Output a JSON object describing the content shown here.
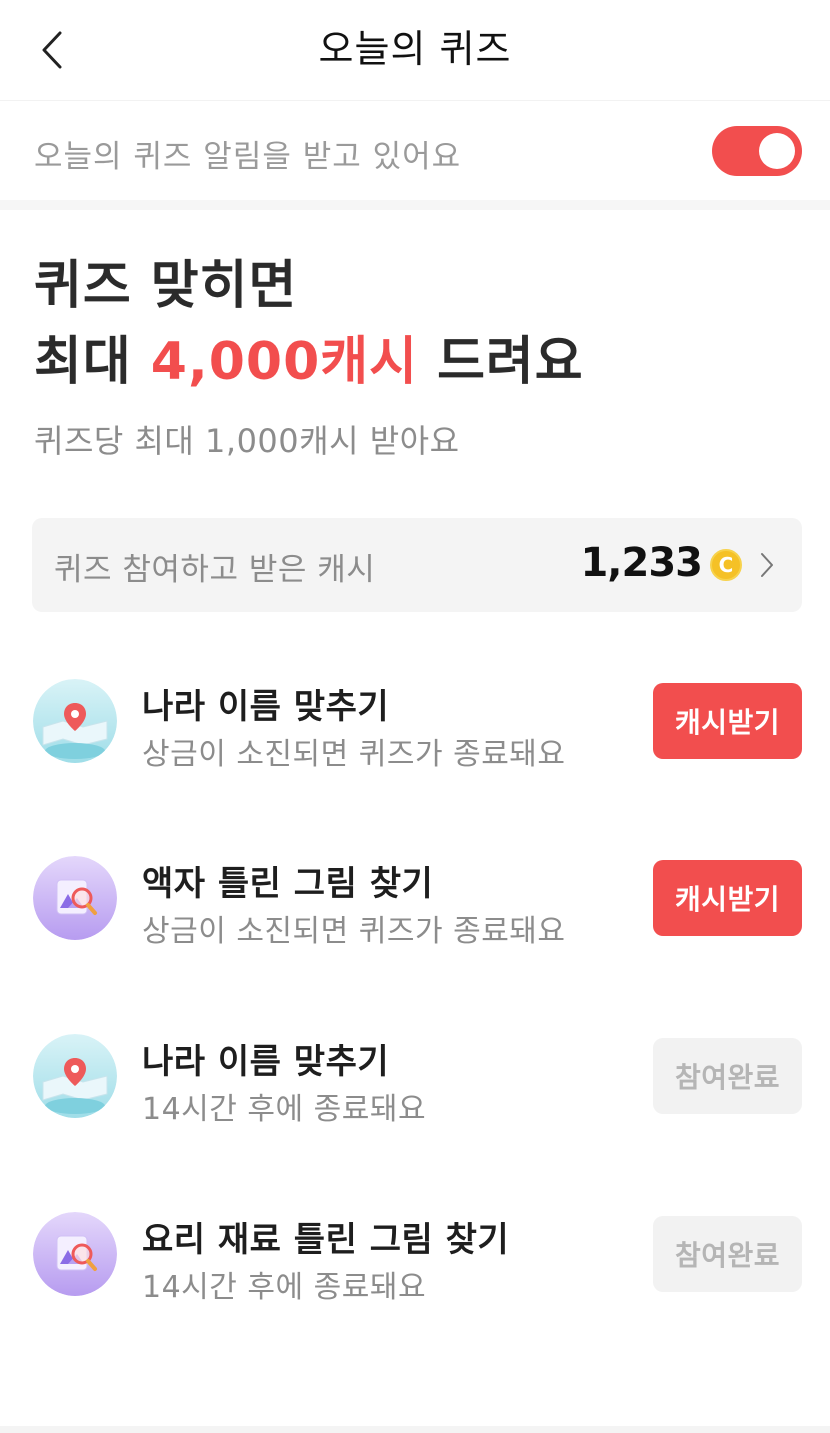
{
  "header": {
    "title": "오늘의 퀴즈",
    "back_icon": "chevron-left-icon"
  },
  "notification": {
    "label": "오늘의 퀴즈 알림을 받고 있어요",
    "toggle_on": true,
    "toggle_color": "#f24e4e"
  },
  "hero": {
    "line1": "퀴즈 맞히면",
    "line2_prefix": "최대 ",
    "line2_accent": "4,000캐시",
    "line2_suffix": " 드려요",
    "subtitle": "퀴즈당 최대 1,000캐시 받아요",
    "accent_color": "#f24e4e"
  },
  "earned": {
    "label": "퀴즈 참여하고 받은 캐시",
    "value": "1,233",
    "coin_symbol": "C",
    "coin_icon": "coin-icon"
  },
  "quizzes": [
    {
      "title": "나라 이름 맞추기",
      "subtitle": "상금이 소진되면 퀴즈가 종료돼요",
      "button": "캐시받기",
      "status": "active",
      "icon": "map-pin-icon"
    },
    {
      "title": "액자 틀린 그림 찾기",
      "subtitle": "상금이 소진되면 퀴즈가 종료돼요",
      "button": "캐시받기",
      "status": "active",
      "icon": "picture-magnifier-icon"
    },
    {
      "title": "나라 이름 맞추기",
      "subtitle": "14시간 후에 종료돼요",
      "button": "참여완료",
      "status": "done",
      "icon": "map-pin-icon"
    },
    {
      "title": "요리 재료 틀린 그림 찾기",
      "subtitle": "14시간 후에 종료돼요",
      "button": "참여완료",
      "status": "done",
      "icon": "picture-magnifier-icon"
    }
  ]
}
